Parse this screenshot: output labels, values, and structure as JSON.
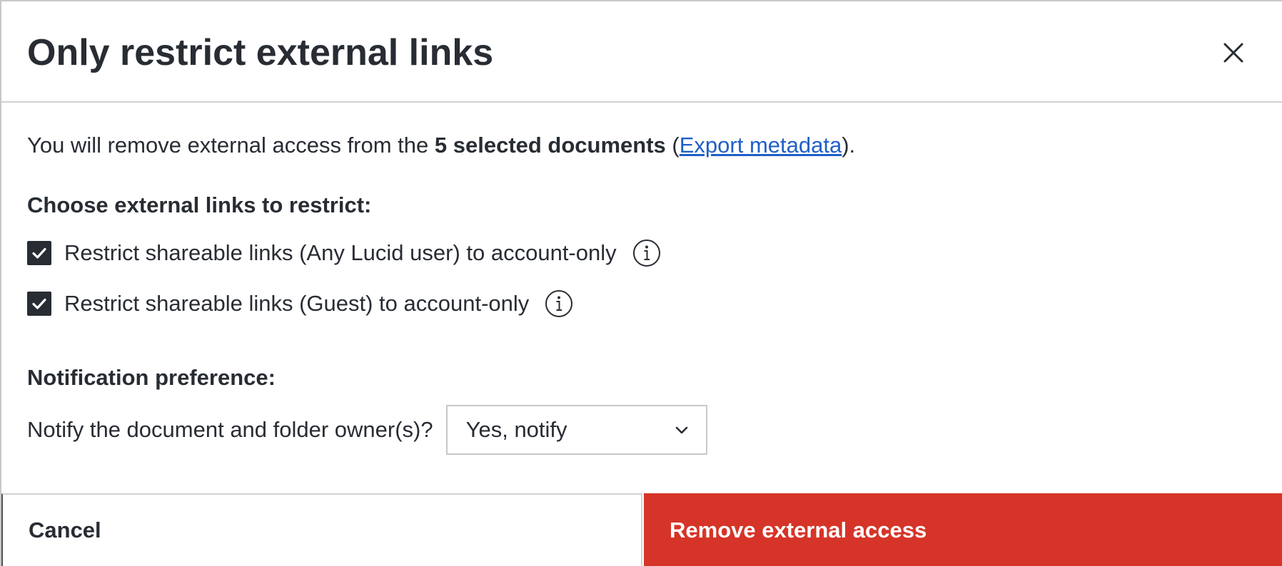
{
  "dialog": {
    "title": "Only restrict external links",
    "close_icon": "close-icon"
  },
  "intro": {
    "prefix": "You will remove external access from the ",
    "bold": "5 selected documents",
    "paren_open": " (",
    "link": "Export metadata",
    "paren_close": ")."
  },
  "links_section": {
    "label": "Choose external links to restrict:",
    "options": [
      {
        "label": "Restrict shareable links (Any Lucid user) to account-only",
        "checked": true,
        "icon": "info-icon"
      },
      {
        "label": "Restrict shareable links (Guest) to account-only",
        "checked": true,
        "icon": "info-icon"
      }
    ]
  },
  "notification": {
    "label": "Notification preference:",
    "question": "Notify the document and folder owner(s)?",
    "selected": "Yes, notify",
    "dropdown_icon": "chevron-down-icon"
  },
  "footer": {
    "cancel_label": "Cancel",
    "confirm_label": "Remove external access"
  },
  "colors": {
    "text": "#282c33",
    "link": "#1f5fc7",
    "danger": "#d63428",
    "border": "#c8c8c8"
  }
}
